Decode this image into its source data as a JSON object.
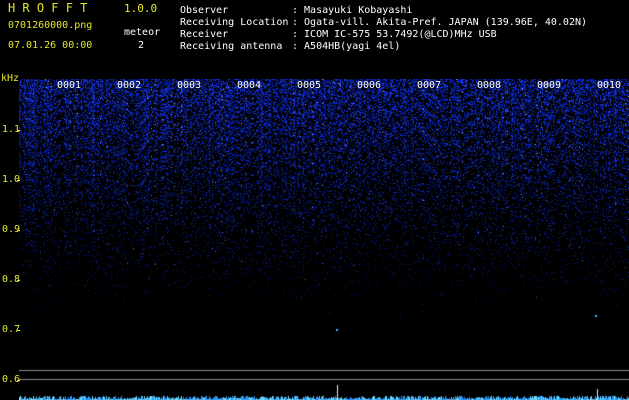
{
  "app": {
    "title": "HROFFT",
    "version": "1.0.0"
  },
  "file": {
    "name": "0701260000.png",
    "datetime": "07.01.26 00:00"
  },
  "meteor": {
    "label": "meteor",
    "count": "2"
  },
  "info": [
    {
      "label": "Observer",
      "value": ": Masayuki Kobayashi"
    },
    {
      "label": "Receiving Location",
      "value": ": Ogata-vill. Akita-Pref. JAPAN (139.96E, 40.02N)"
    },
    {
      "label": "Receiver",
      "value": ": ICOM IC-575 53.7492(@LCD)MHz USB"
    },
    {
      "label": "Receiving antenna",
      "value": ": A504HB(yagi 4el)"
    }
  ],
  "axis": {
    "unit": "kHz",
    "ticks": [
      "1.1",
      "1.0",
      "0.9",
      "0.8",
      "0.7",
      "0.6"
    ],
    "minutes": [
      "0001",
      "0002",
      "0003",
      "0004",
      "0005",
      "0006",
      "0007",
      "0008",
      "0009",
      "0010"
    ]
  },
  "colors": {
    "label": "#e6e62a",
    "signal": "#1e3cff",
    "text": "#ffffff"
  }
}
